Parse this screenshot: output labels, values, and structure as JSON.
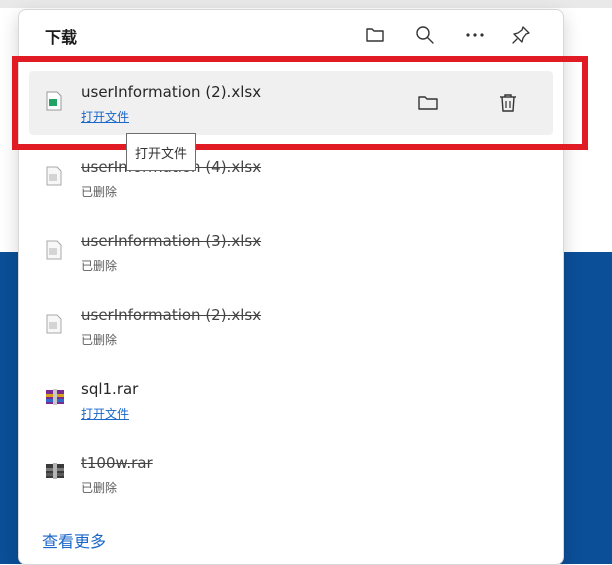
{
  "panel": {
    "title": "下载",
    "header_icons": [
      "folder-icon",
      "search-icon",
      "more-icon",
      "pin-icon"
    ]
  },
  "items": [
    {
      "name": "userInformation (2).xlsx",
      "status": "打开文件",
      "type": "xlsx",
      "deleted": false,
      "icon": "excel-file-icon"
    },
    {
      "name": "userInformation (4).xlsx",
      "status": "已删除",
      "type": "xlsx",
      "deleted": true,
      "icon": "file-icon"
    },
    {
      "name": "userInformation (3).xlsx",
      "status": "已删除",
      "type": "xlsx",
      "deleted": true,
      "icon": "file-icon"
    },
    {
      "name": "userInformation (2).xlsx",
      "status": "已删除",
      "type": "xlsx",
      "deleted": true,
      "icon": "file-icon"
    },
    {
      "name": "sql1.rar",
      "status": "打开文件",
      "type": "rar",
      "deleted": false,
      "icon": "rar-archive-icon"
    },
    {
      "name": "t100w.rar",
      "status": "已删除",
      "type": "rar",
      "deleted": true,
      "icon": "rar-archive-icon"
    }
  ],
  "tooltip": "打开文件",
  "see_more": "查看更多",
  "colors": {
    "accent": "#1a66c9",
    "highlight": "#e01b24",
    "background_blue": "#0b4f98"
  }
}
